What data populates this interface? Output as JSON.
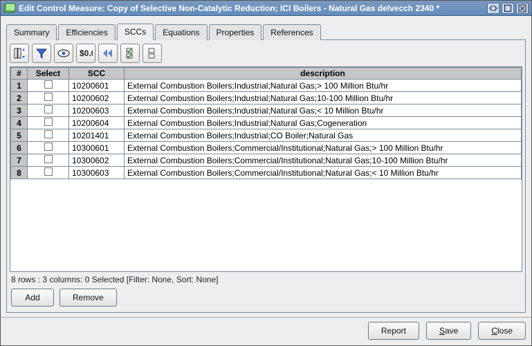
{
  "window": {
    "title": "Edit Control Measure: Copy of Selective Non-Catalytic Reduction; ICI Boilers - Natural Gas delvecch 2340 *"
  },
  "tabs": {
    "items": [
      {
        "label": "Summary"
      },
      {
        "label": "Efficiencies"
      },
      {
        "label": "SCCs"
      },
      {
        "label": "Equations"
      },
      {
        "label": "Properties"
      },
      {
        "label": "References"
      }
    ],
    "active": 2
  },
  "grid": {
    "headers": {
      "row": "#",
      "select": "Select",
      "scc": "SCC",
      "desc": "description"
    },
    "rows": [
      {
        "n": "1",
        "scc": "10200601",
        "desc": "External Combustion Boilers;Industrial;Natural Gas;> 100 Million Btu/hr"
      },
      {
        "n": "2",
        "scc": "10200602",
        "desc": "External Combustion Boilers;Industrial;Natural Gas;10-100 Million Btu/hr"
      },
      {
        "n": "3",
        "scc": "10200603",
        "desc": "External Combustion Boilers;Industrial;Natural Gas;< 10 Million Btu/hr"
      },
      {
        "n": "4",
        "scc": "10200604",
        "desc": "External Combustion Boilers;Industrial;Natural Gas;Cogeneration"
      },
      {
        "n": "5",
        "scc": "10201401",
        "desc": "External Combustion Boilers;Industrial;CO Boiler;Natural Gas"
      },
      {
        "n": "6",
        "scc": "10300601",
        "desc": "External Combustion Boilers;Commercial/Institutional;Natural Gas;> 100 Million Btu/hr"
      },
      {
        "n": "7",
        "scc": "10300602",
        "desc": "External Combustion Boilers;Commercial/Institutional;Natural Gas;10-100 Million Btu/hr"
      },
      {
        "n": "8",
        "scc": "10300603",
        "desc": "External Combustion Boilers;Commercial/Institutional;Natural Gas;< 10 Million Btu/hr"
      }
    ]
  },
  "status": "8 rows : 3 columns: 0 Selected [Filter: None, Sort: None]",
  "subbtns": {
    "add": "Add",
    "remove": "Remove"
  },
  "footer": {
    "report": "Report",
    "save_u": "S",
    "save_rest": "ave",
    "close_u": "C",
    "close_rest": "lose"
  }
}
